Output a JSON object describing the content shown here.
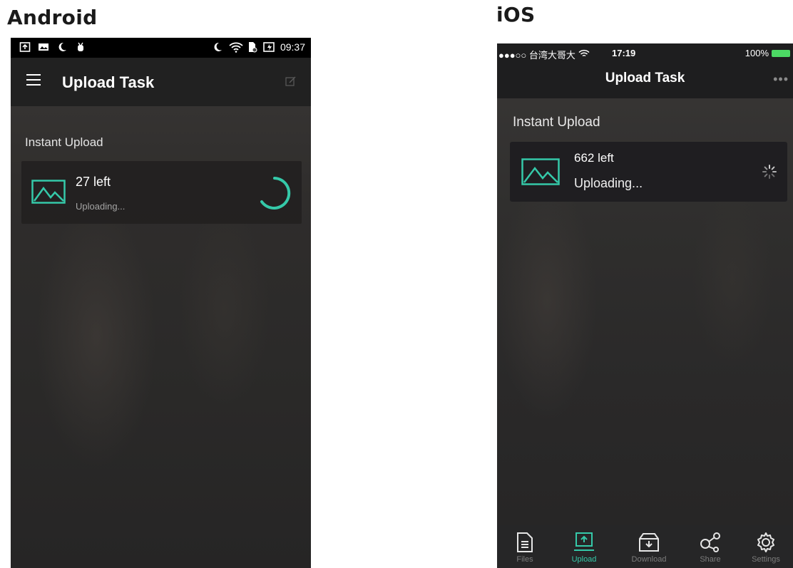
{
  "android": {
    "platform_title": "Android",
    "status_bar": {
      "time": "09:37"
    },
    "app_bar": {
      "title": "Upload Task"
    },
    "section_title": "Instant Upload",
    "task": {
      "count": "27 left",
      "status": "Uploading..."
    }
  },
  "ios": {
    "platform_title": "iOS",
    "status_bar": {
      "carrier": "●●●○○ 台湾大哥大",
      "time": "17:19",
      "battery": "100%"
    },
    "nav_bar": {
      "title": "Upload Task",
      "more": "•••"
    },
    "section_title": "Instant Upload",
    "task": {
      "count": "662 left",
      "status": "Uploading..."
    },
    "tabs": [
      {
        "label": "Files",
        "icon": "files-icon"
      },
      {
        "label": "Upload",
        "icon": "upload-icon",
        "active": true
      },
      {
        "label": "Download",
        "icon": "download-icon"
      },
      {
        "label": "Share",
        "icon": "share-icon"
      },
      {
        "label": "Settings",
        "icon": "settings-icon"
      }
    ]
  },
  "colors": {
    "accent": "#35c9a9",
    "app_bar": "#212121",
    "card": "#211f1f"
  }
}
